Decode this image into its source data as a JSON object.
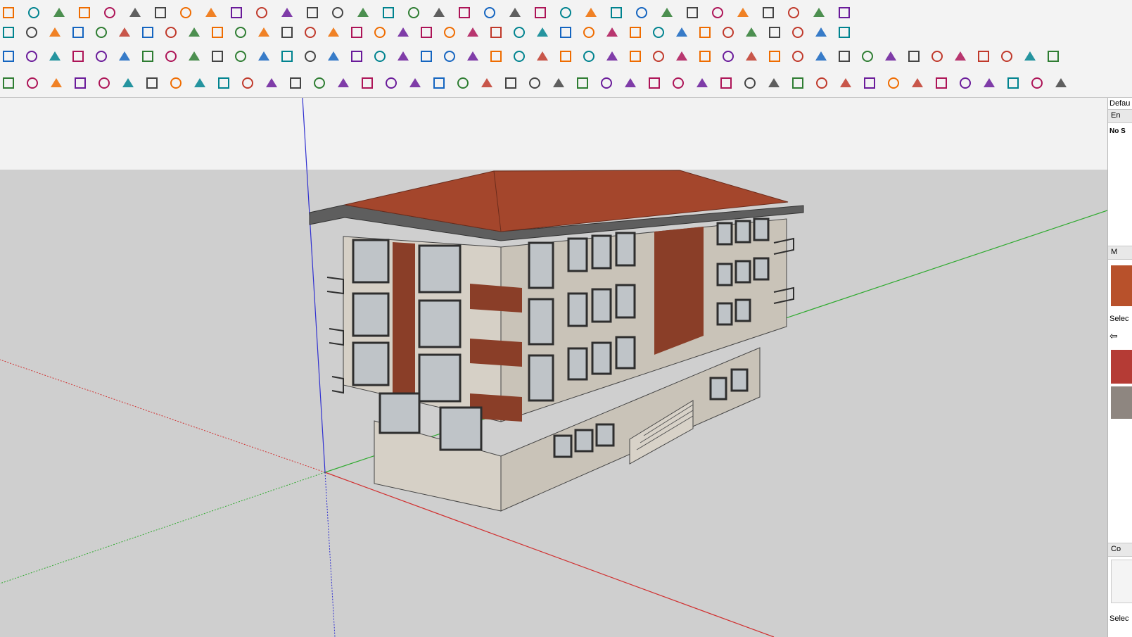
{
  "window": {
    "colors": {
      "sky": "#f2f2f2",
      "ground": "#cfcfcf",
      "axis_red": "#d03030",
      "axis_green": "#2faa2f",
      "axis_blue": "#3030d0"
    }
  },
  "toolbars": {
    "row1_icons": [
      "eraser-icon",
      "pencil-icon",
      "dropdown-arrow-icon",
      "paint-icon",
      "dropdown-arrow-icon",
      "push-pull-icon",
      "dropdown-arrow-icon",
      "follow-me-icon",
      "rotate-icon",
      "move-icon",
      "orbit-icon",
      "offset-icon",
      "tape-measure-icon",
      "dimension-icon",
      "protractor-icon",
      "text-icon",
      "axes-icon",
      "section-plane-icon",
      "zoom-icon",
      "zoom-extents-icon",
      "walk-icon",
      "look-around-icon",
      "position-camera-icon",
      "warehouse-icon",
      "extension-icon",
      "model-info-icon",
      "styles-icon",
      "shadows-icon",
      "layers-icon",
      "sandbox-icon",
      "dropdown-arrow-icon",
      "record-icon",
      "stop-icon",
      "play-icon"
    ],
    "row2_icons": [
      "line-tool-icon",
      "curve-icon",
      "scissors-icon",
      "gear-icon",
      "freehand-icon",
      "bend-icon",
      "box-icon",
      "sphere-icon",
      "cone-icon",
      "arc-icon",
      "corner-icon",
      "angle-icon",
      "pipe-icon",
      "arch-icon",
      "roof-icon",
      "fence-icon",
      "column-icon",
      "grid-icon",
      "hand-icon",
      "sheet-icon",
      "stairs-icon",
      "ramp-icon",
      "railing-icon",
      "beam-icon",
      "truss-icon",
      "fan-icon",
      "wall-icon",
      "panel-icon",
      "hatch-icon",
      "stripe-icon",
      "bars-icon",
      "louver-icon",
      "dome-icon",
      "frame-icon",
      "tower-icon",
      "mesh-icon",
      "house-icon"
    ],
    "row3_icons": [
      "arrow-icon",
      "plane-yellow-icon",
      "plane-green-icon",
      "plane-red-icon",
      "plane-white-icon",
      "spiral-icon",
      "square-red-icon",
      "stack-icon",
      "flag-icon",
      "chest-icon",
      "wrench-icon",
      "clip-icon",
      "point-icon",
      "cross-red-icon",
      "cross-green-icon",
      "cross-blue-icon",
      "cone-cyan-icon",
      "drop-icon",
      "warning-icon",
      "loop-icon",
      "loop-orange-icon",
      "refresh-icon",
      "compass-icon",
      "bucket-icon",
      "magnet-icon",
      "puzzle-icon",
      "component-icon",
      "group-icon",
      "explode-icon",
      "sun-icon",
      "cube-icon",
      "frame-blue-icon",
      "grid-orange-icon",
      "grid-yellow-icon",
      "grid-orange-2-icon",
      "dots-icon",
      "curve-points-icon",
      "array-icon",
      "ruler-icon",
      "dimension-2-icon",
      "eye-icon",
      "pyramid-icon",
      "shape-icon",
      "shape-blue-icon",
      "brush-icon",
      "scale-icon"
    ],
    "row4_icons": [
      "paint-yellow-icon",
      "polygon-icon",
      "arc-tool-icon",
      "spline-icon",
      "spring-icon",
      "curve-tool-icon",
      "bezier-icon",
      "arc-green-icon",
      "rectangle-icon",
      "circle-icon",
      "arc-2-icon",
      "zigzag-icon",
      "hook-icon",
      "arc-3-icon",
      "arc-4-icon",
      "check-icon",
      "octagon-icon",
      "wrench-green-icon",
      "ellipse-icon",
      "pen-icon",
      "terrain-icon",
      "terrain-2-icon",
      "select-icon",
      "plus-square-icon",
      "minus-square-icon",
      "align-center-icon",
      "align-add-icon",
      "align-sub-icon",
      "line-h-icon",
      "line-add-icon",
      "line-sub-icon",
      "box-outline-icon",
      "box-grid-icon",
      "box-cross-icon",
      "table-icon",
      "table-blue-icon",
      "table-cross-icon",
      "texture-icon",
      "texture-2-icon",
      "cloud-icon",
      "checker-icon",
      "copy-icon",
      "tag-icon",
      "hierarchy-icon",
      "panel-toggle-icon"
    ]
  },
  "tray": {
    "default_label": "Defau",
    "entity_section": "En",
    "no_selection_label": "No S",
    "materials_section": "M",
    "select_label": "Selec",
    "components_section": "Co",
    "select_label_2": "Selec",
    "swatches": [
      {
        "name": "roof-tile-swatch",
        "color": "#b8512b"
      },
      {
        "name": "red-material-swatch",
        "color": "#b53b35"
      },
      {
        "name": "stone-material-swatch",
        "color": "#8e8680"
      }
    ]
  },
  "scene": {
    "building_colors": {
      "roof": "#a4462c",
      "roof_edge": "#5e5e5e",
      "wall": "#d6d0c6",
      "wall_shade": "#c9c3b8",
      "cladding": "#8a3e28",
      "window_frame": "#2e2e2e",
      "glass": "#bfc4c8"
    }
  }
}
